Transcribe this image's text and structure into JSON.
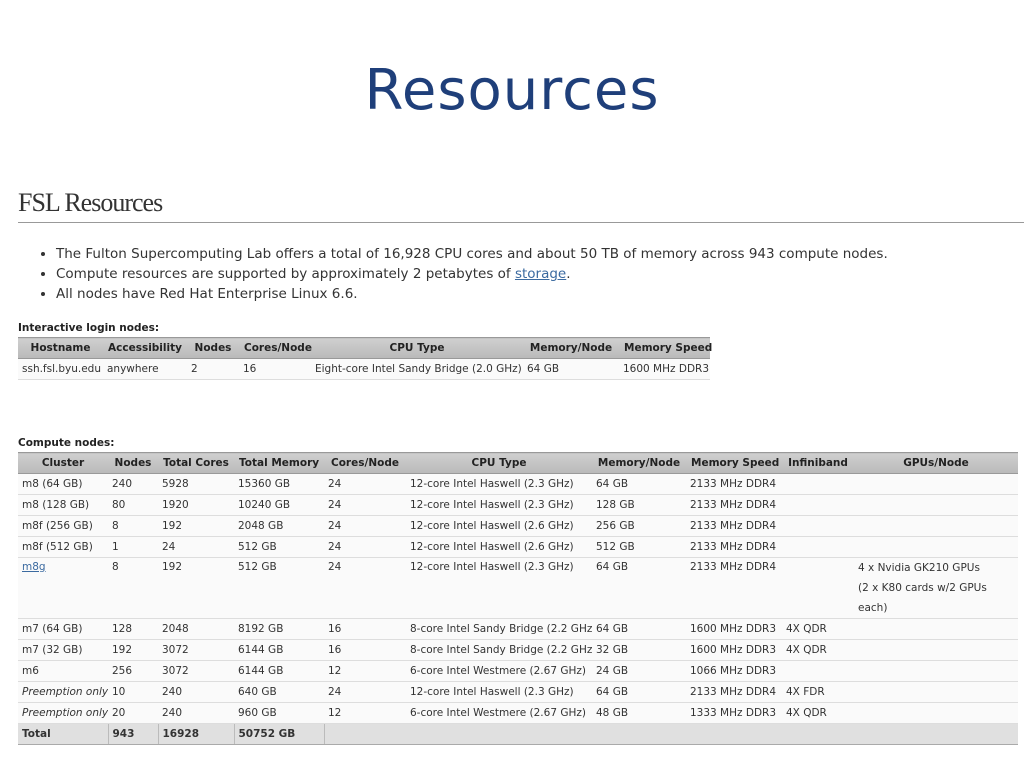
{
  "slide": {
    "title": "Resources"
  },
  "page": {
    "heading": "FSL Resources",
    "bullets": [
      {
        "text": "The Fulton Supercomputing Lab offers a total of 16,928 CPU cores and about 50 TB of memory across 943 compute nodes."
      },
      {
        "before": "Compute resources are supported by approximately 2 petabytes of ",
        "link": "storage",
        "after": "."
      },
      {
        "text": "All nodes have Red Hat Enterprise Linux 6.6."
      }
    ]
  },
  "login": {
    "label": "Interactive login nodes:",
    "headers": [
      "Hostname",
      "Accessibility",
      "Nodes",
      "Cores/Node",
      "CPU Type",
      "Memory/Node",
      "Memory Speed"
    ],
    "rows": [
      [
        "ssh.fsl.byu.edu",
        "anywhere",
        "2",
        "16",
        "Eight-core Intel Sandy Bridge (2.0 GHz)",
        "64 GB",
        "1600 MHz DDR3"
      ]
    ]
  },
  "compute": {
    "label": "Compute nodes:",
    "headers": [
      "Cluster",
      "Nodes",
      "Total Cores",
      "Total Memory",
      "Cores/Node",
      "CPU Type",
      "Memory/Node",
      "Memory Speed",
      "Infiniband",
      "GPUs/Node"
    ],
    "rows": [
      [
        "m8 (64 GB)",
        "240",
        "5928",
        "15360 GB",
        "24",
        "12-core Intel Haswell (2.3 GHz)",
        "64 GB",
        "2133 MHz DDR4",
        "",
        ""
      ],
      [
        "m8 (128 GB)",
        "80",
        "1920",
        "10240 GB",
        "24",
        "12-core Intel Haswell (2.3 GHz)",
        "128 GB",
        "2133 MHz DDR4",
        "",
        ""
      ],
      [
        "m8f (256 GB)",
        "8",
        "192",
        "2048 GB",
        "24",
        "12-core Intel Haswell (2.6 GHz)",
        "256 GB",
        "2133 MHz DDR4",
        "",
        ""
      ],
      [
        "m8f (512 GB)",
        "1",
        "24",
        "512 GB",
        "24",
        "12-core Intel Haswell (2.6 GHz)",
        "512 GB",
        "2133 MHz DDR4",
        "",
        ""
      ],
      [
        "m8g",
        "8",
        "192",
        "512 GB",
        "24",
        "12-core Intel Haswell (2.3 GHz)",
        "64 GB",
        "2133 MHz DDR4",
        "",
        "4 x Nvidia GK210 GPUs"
      ],
      [
        "m7 (64 GB)",
        "128",
        "2048",
        "8192 GB",
        "16",
        "8-core Intel Sandy Bridge (2.2 GHz)",
        "64 GB",
        "1600 MHz DDR3",
        "4X QDR",
        ""
      ],
      [
        "m7 (32 GB)",
        "192",
        "3072",
        "6144 GB",
        "16",
        "8-core Intel Sandy Bridge (2.2 GHz)",
        "32 GB",
        "1600 MHz DDR3",
        "4X QDR",
        ""
      ],
      [
        "m6",
        "256",
        "3072",
        "6144 GB",
        "12",
        "6-core Intel Westmere (2.67 GHz)",
        "24 GB",
        "1066 MHz DDR3",
        "",
        ""
      ],
      [
        "Preemption only",
        "10",
        "240",
        "640 GB",
        "24",
        "12-core Intel Haswell (2.3 GHz)",
        "64 GB",
        "2133 MHz DDR4",
        "4X FDR",
        ""
      ],
      [
        "Preemption only",
        "20",
        "240",
        "960 GB",
        "12",
        "6-core Intel Westmere (2.67 GHz)",
        "48 GB",
        "1333 MHz DDR3",
        "4X QDR",
        ""
      ]
    ],
    "m8g_gpu_note": "(2 x K80 cards w/2 GPUs each)",
    "total": {
      "label": "Total",
      "nodes": "943",
      "cores": "16928",
      "memory": "50752 GB"
    }
  }
}
